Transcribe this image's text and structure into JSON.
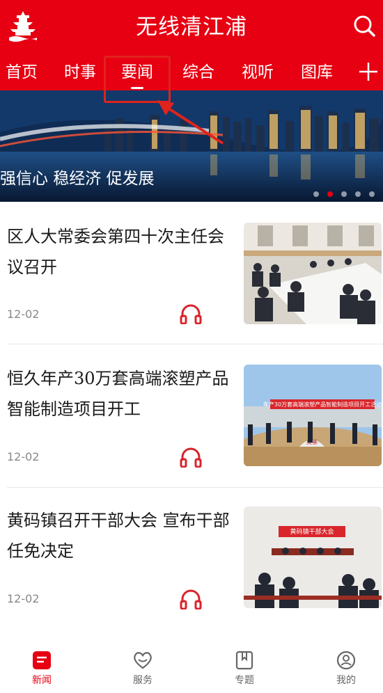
{
  "app": {
    "title": "无线清江浦",
    "accent": "#e60012"
  },
  "header": {
    "logo_icon": "pagoda-logo-icon",
    "search_icon": "search-icon"
  },
  "tabs": [
    {
      "label": "首页"
    },
    {
      "label": "时事"
    },
    {
      "label": "要闻",
      "active": true
    },
    {
      "label": "综合"
    },
    {
      "label": "视听"
    },
    {
      "label": "图库"
    }
  ],
  "add_tab_icon": "plus-icon",
  "banner": {
    "caption": "强信心 稳经济 促发展",
    "slide_count": 5,
    "active_slide": 2
  },
  "news": [
    {
      "title": "区人大常委会第四十次主任会议召开",
      "date": "12-02",
      "icon": "headphones-icon"
    },
    {
      "title": "恒久年产30万套高端滚塑产品智能制造项目开工",
      "date": "12-02",
      "icon": "headphones-icon"
    },
    {
      "title": "黄码镇召开干部大会 宣布干部任免决定",
      "date": "12-02",
      "icon": "headphones-icon"
    }
  ],
  "thumb_text": {
    "project_banner": "年产30万套高端滚塑产品智能制造项目开工活动",
    "stone": "奠基",
    "meeting_banner": "黄码镇干部大会"
  },
  "tabbar": [
    {
      "label": "新闻",
      "icon": "news-icon",
      "active": true
    },
    {
      "label": "服务",
      "icon": "heart-icon"
    },
    {
      "label": "专题",
      "icon": "bookmark-icon"
    },
    {
      "label": "我的",
      "icon": "user-icon"
    }
  ]
}
